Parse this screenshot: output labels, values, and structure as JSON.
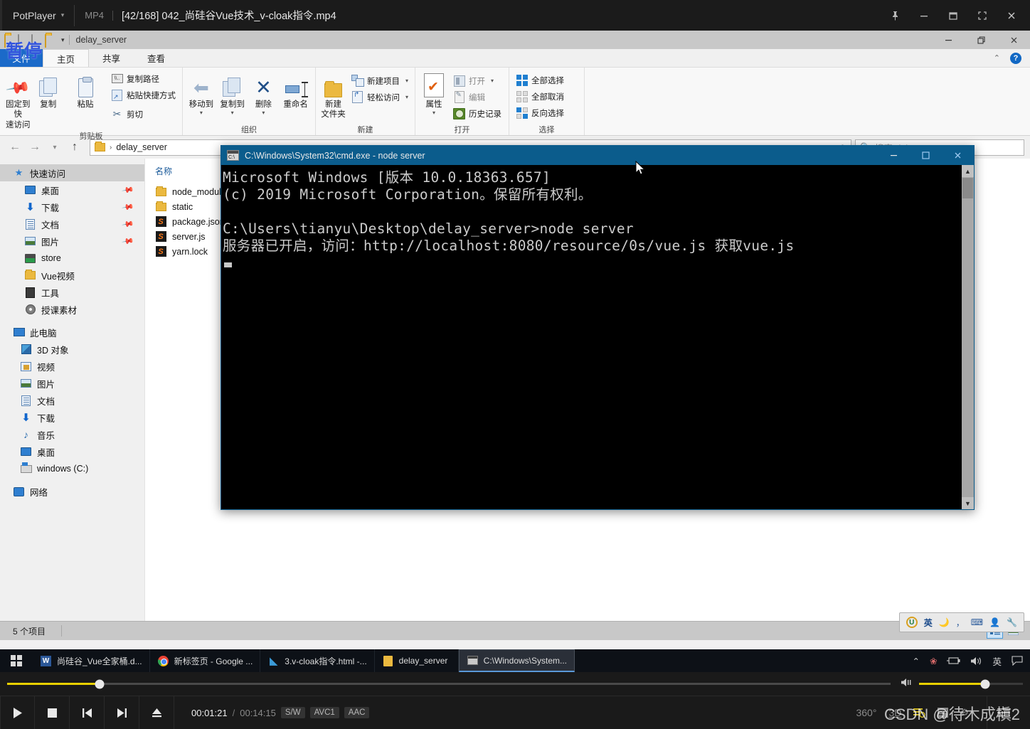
{
  "player": {
    "brand": "PotPlayer",
    "format": "MP4",
    "file_title": "[42/168] 042_尚硅谷Vue技术_v-cloak指令.mp4",
    "pause_overlay": "暂停",
    "time_current": "00:01:21",
    "time_separator": "/",
    "time_total": "00:14:15",
    "badges": [
      "S/W",
      "AVC1",
      "AAC"
    ],
    "right_icons": [
      "360-icon",
      "3d-icon",
      "playlist-icon",
      "subtitle-icon",
      "settings-icon",
      "menu-icon"
    ],
    "label_360": "360°",
    "label_3d": "3D",
    "window_buttons": [
      "pin-icon",
      "minimize-icon",
      "maximize-icon",
      "fullscreen-icon",
      "close-icon"
    ],
    "transport_buttons": [
      "play-icon",
      "stop-icon",
      "previous-icon",
      "next-icon",
      "eject-icon"
    ],
    "seek_percent": 9,
    "volume_percent": 64
  },
  "watermark": "CSDN @待木成槇2",
  "explorer": {
    "quick_access_title": "delay_server",
    "title_buttons": [
      "minimize-icon",
      "restore-icon",
      "close-icon"
    ],
    "tabs": [
      {
        "label": "文件",
        "name": "tab-file"
      },
      {
        "label": "主页",
        "name": "tab-home"
      },
      {
        "label": "共享",
        "name": "tab-share"
      },
      {
        "label": "查看",
        "name": "tab-view"
      }
    ],
    "ribbon": {
      "groups": [
        {
          "label": "剪贴板",
          "big": [
            {
              "label": "固定到快\n速访问",
              "icon": "pin-icon"
            },
            {
              "label": "复制",
              "icon": "copy-icon"
            },
            {
              "label": "粘贴",
              "icon": "paste-icon"
            }
          ],
          "small": [
            {
              "label": "剪切",
              "icon": "scissors-icon"
            }
          ],
          "small2": [
            {
              "label": "复制路径",
              "icon": "copy-path-icon"
            },
            {
              "label": "粘贴快捷方式",
              "icon": "paste-shortcut-icon"
            }
          ]
        },
        {
          "label": "组织",
          "big": [
            {
              "label": "移动到",
              "icon": "move-to-icon"
            },
            {
              "label": "复制到",
              "icon": "copy-to-icon"
            },
            {
              "label": "删除",
              "icon": "delete-icon"
            },
            {
              "label": "重命名",
              "icon": "rename-icon"
            }
          ]
        },
        {
          "label": "新建",
          "big": [
            {
              "label": "新建\n文件夹",
              "icon": "new-folder-icon"
            }
          ],
          "small2": [
            {
              "label": "新建项目",
              "icon": "new-item-icon"
            },
            {
              "label": "轻松访问",
              "icon": "easy-access-icon"
            }
          ]
        },
        {
          "label": "打开",
          "big": [
            {
              "label": "属性",
              "icon": "properties-icon"
            }
          ],
          "small2": [
            {
              "label": "打开",
              "icon": "open-icon"
            },
            {
              "label": "编辑",
              "icon": "edit-icon"
            },
            {
              "label": "历史记录",
              "icon": "history-icon"
            }
          ]
        },
        {
          "label": "选择",
          "small2": [
            {
              "label": "全部选择",
              "icon": "select-all-icon"
            },
            {
              "label": "全部取消",
              "icon": "select-none-icon"
            },
            {
              "label": "反向选择",
              "icon": "invert-selection-icon"
            }
          ]
        }
      ]
    },
    "address": {
      "path_label": "delay_server",
      "separator": "›",
      "search_placeholder": "搜索\"delay_server\"",
      "nav_icons": [
        "back-icon",
        "forward-icon",
        "recent-locations-icon",
        "up-icon"
      ],
      "refresh_icon": "refresh-icon",
      "dropdown_icon": "chevron-down-icon"
    },
    "nav_pane": [
      {
        "label": "快速访问",
        "icon": "quick-access-star-icon",
        "level": 0,
        "selected": true,
        "pin": false
      },
      {
        "label": "桌面",
        "icon": "desktop-icon",
        "level": 1,
        "selected": false,
        "pin": true
      },
      {
        "label": "下载",
        "icon": "downloads-icon",
        "level": 1,
        "selected": false,
        "pin": true
      },
      {
        "label": "文档",
        "icon": "documents-icon",
        "level": 1,
        "selected": false,
        "pin": true
      },
      {
        "label": "图片",
        "icon": "pictures-icon",
        "level": 1,
        "selected": false,
        "pin": true
      },
      {
        "label": "store",
        "icon": "store-folder-icon",
        "level": 1,
        "selected": false,
        "pin": false
      },
      {
        "label": "Vue视频",
        "icon": "folder-icon",
        "level": 1,
        "selected": false,
        "pin": false
      },
      {
        "label": "工具",
        "icon": "tools-folder-icon",
        "level": 1,
        "selected": false,
        "pin": false
      },
      {
        "label": "授课素材",
        "icon": "disc-folder-icon",
        "level": 1,
        "selected": false,
        "pin": false
      },
      {
        "label": "此电脑",
        "icon": "this-pc-icon",
        "level": 0,
        "selected": false,
        "pin": false
      },
      {
        "label": "3D 对象",
        "icon": "3d-objects-icon",
        "level": 1,
        "selected": false,
        "pin": false
      },
      {
        "label": "视频",
        "icon": "videos-icon",
        "level": 1,
        "selected": false,
        "pin": false
      },
      {
        "label": "图片",
        "icon": "pictures-icon",
        "level": 1,
        "selected": false,
        "pin": false
      },
      {
        "label": "文档",
        "icon": "documents-icon",
        "level": 1,
        "selected": false,
        "pin": false
      },
      {
        "label": "下载",
        "icon": "downloads-icon",
        "level": 1,
        "selected": false,
        "pin": false
      },
      {
        "label": "音乐",
        "icon": "music-icon",
        "level": 1,
        "selected": false,
        "pin": false
      },
      {
        "label": "桌面",
        "icon": "desktop-icon",
        "level": 1,
        "selected": false,
        "pin": false
      },
      {
        "label": "windows (C:)",
        "icon": "drive-icon",
        "level": 1,
        "selected": false,
        "pin": false
      },
      {
        "label": "网络",
        "icon": "network-icon",
        "level": 0,
        "selected": false,
        "pin": false
      }
    ],
    "list": {
      "column_header": "名称",
      "items": [
        {
          "name": "node_module",
          "icon": "folder-icon"
        },
        {
          "name": "static",
          "icon": "folder-icon"
        },
        {
          "name": "package.json",
          "icon": "sublime-file-icon"
        },
        {
          "name": "server.js",
          "icon": "sublime-file-icon"
        },
        {
          "name": "yarn.lock",
          "icon": "sublime-file-icon"
        }
      ]
    },
    "status": {
      "item_count": "5 个项目"
    },
    "view_buttons": [
      "details-view-icon",
      "large-icons-view-icon"
    ],
    "ime": {
      "items": [
        "ime-logo-icon",
        "英",
        "moon-icon",
        "punctuation-icon",
        "keyboard-icon",
        "user-icon",
        "settings-wrench-icon"
      ],
      "mode": "英"
    },
    "help_icon": "help-icon",
    "collapse_ribbon_icon": "chevron-up-icon"
  },
  "cmd": {
    "title": "C:\\Windows\\System32\\cmd.exe - node  server",
    "icon": "cmd-icon",
    "buttons": [
      "minimize-icon",
      "maximize-icon",
      "close-icon"
    ],
    "lines": [
      "Microsoft Windows [版本 10.0.18363.657]",
      "(c) 2019 Microsoft Corporation。保留所有权利。",
      "",
      "C:\\Users\\tianyu\\Desktop\\delay_server>node server",
      "服务器已开启，访问：http://localhost:8080/resource/0s/vue.js 获取vue.js"
    ]
  },
  "taskbar": {
    "start_icon": "windows-start-icon",
    "items": [
      {
        "label": "尚硅谷_Vue全家桶.d...",
        "icon": "word-icon",
        "active": false
      },
      {
        "label": "新标签页 - Google ...",
        "icon": "chrome-icon",
        "active": false
      },
      {
        "label": "3.v-cloak指令.html -...",
        "icon": "vscode-icon",
        "active": false
      },
      {
        "label": "delay_server",
        "icon": "folder-icon",
        "active": false
      },
      {
        "label": "C:\\Windows\\System...",
        "icon": "cmd-icon",
        "active": true
      }
    ],
    "tray": [
      "show-hidden-icons-icon",
      "flower-icon",
      "battery-icon",
      "volume-icon",
      "英",
      "notifications-icon"
    ],
    "tray_ime": "英"
  }
}
